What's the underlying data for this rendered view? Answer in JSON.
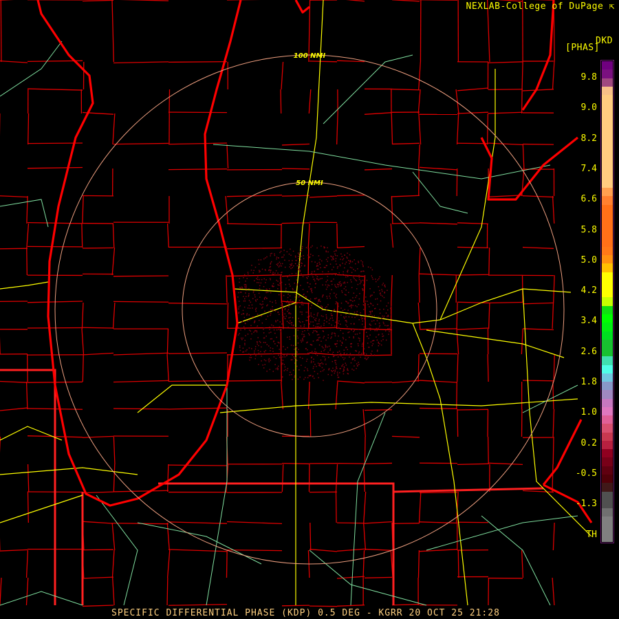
{
  "header": {
    "credit": "NEXLAB-College of DuPage",
    "credit_icon": "logo-arrow-icon",
    "product_code": "DKD",
    "unit": "[PHAS]"
  },
  "caption": "SPECIFIC DIFFERENTIAL PHASE (KDP) 0.5 DEG - KGRR 20 OCT 25 21:28",
  "range_rings": [
    {
      "label": "100 NMI",
      "nmi": 100
    },
    {
      "label": "50 NMI",
      "nmi": 50
    }
  ],
  "legend": {
    "labels": [
      "9.8",
      "9.0",
      "8.2",
      "7.4",
      "6.6",
      "5.8",
      "5.0",
      "4.2",
      "3.4",
      "2.6",
      "1.8",
      "1.0",
      "0.2",
      "-0.5",
      "-1.3",
      "TH"
    ],
    "colors": [
      "#700080",
      "#7a1080",
      "#a04880",
      "#f8c088",
      "#ffcc80",
      "#ffcc80",
      "#ffcc80",
      "#ffcc80",
      "#ffcc80",
      "#ffcc80",
      "#ffcc80",
      "#ffcc80",
      "#ffcc80",
      "#ffcc80",
      "#ffcc80",
      "#ffa050",
      "#ff8030",
      "#ff7018",
      "#ff7018",
      "#ff7018",
      "#ff7018",
      "#ff7018",
      "#ff7818",
      "#ff9010",
      "#ffc000",
      "#ffff00",
      "#ffff00",
      "#ffff00",
      "#c8ff00",
      "#10e010",
      "#00ff00",
      "#00f010",
      "#00e020",
      "#18c030",
      "#18c030",
      "#40e0b0",
      "#50ffe8",
      "#70c8e0",
      "#8898c8",
      "#a088c0",
      "#c878c0",
      "#e078c0",
      "#e06098",
      "#d85070",
      "#c83850",
      "#b82040",
      "#900020",
      "#780018",
      "#600010",
      "#500008",
      "#401818",
      "#505050",
      "#505050",
      "#707070",
      "#808080",
      "#808080",
      "#808080"
    ]
  },
  "colors": {
    "shoreline": "#ff0000",
    "county_lines": "#e00000",
    "highways": "#ffff00",
    "roads": "#80e0a0",
    "range_ring": "#f0a080",
    "echo": "#800010",
    "text": "#ffff00",
    "caption": "#ffd080"
  }
}
